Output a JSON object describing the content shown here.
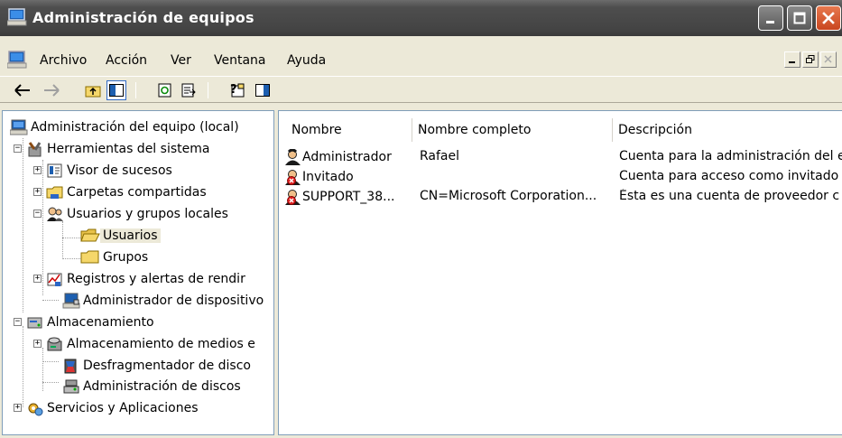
{
  "window": {
    "title": "Administración de equipos"
  },
  "menu": {
    "items": [
      "Archivo",
      "Acción",
      "Ver",
      "Ventana",
      "Ayuda"
    ]
  },
  "tree": {
    "root": "Administración del equipo (local)",
    "system_tools": "Herramientas del sistema",
    "event_viewer": "Visor de sucesos",
    "shared_folders": "Carpetas compartidas",
    "local_users_groups": "Usuarios y grupos locales",
    "users": "Usuarios",
    "groups": "Grupos",
    "perf_logs": "Registros y alertas de rendir",
    "device_manager": "Administrador de dispositivo",
    "storage": "Almacenamiento",
    "removable_storage": "Almacenamiento de medios e",
    "defrag": "Desfragmentador de disco",
    "disk_mgmt": "Administración de discos",
    "services_apps": "Servicios y Aplicaciones"
  },
  "list": {
    "columns": [
      "Nombre",
      "Nombre completo",
      "Descripción"
    ],
    "rows": [
      {
        "name": "Administrador",
        "full": "Rafael",
        "desc": "Cuenta para la administración del e"
      },
      {
        "name": "Invitado",
        "full": "",
        "desc": "Cuenta para acceso como invitado"
      },
      {
        "name": "SUPPORT_38...",
        "full": "CN=Microsoft Corporation...",
        "desc": "Ésta es una cuenta de proveedor c"
      }
    ]
  },
  "colors": {
    "selection": "#ece9d8",
    "border": "#7f9db9",
    "close_button": "#d8562b"
  }
}
